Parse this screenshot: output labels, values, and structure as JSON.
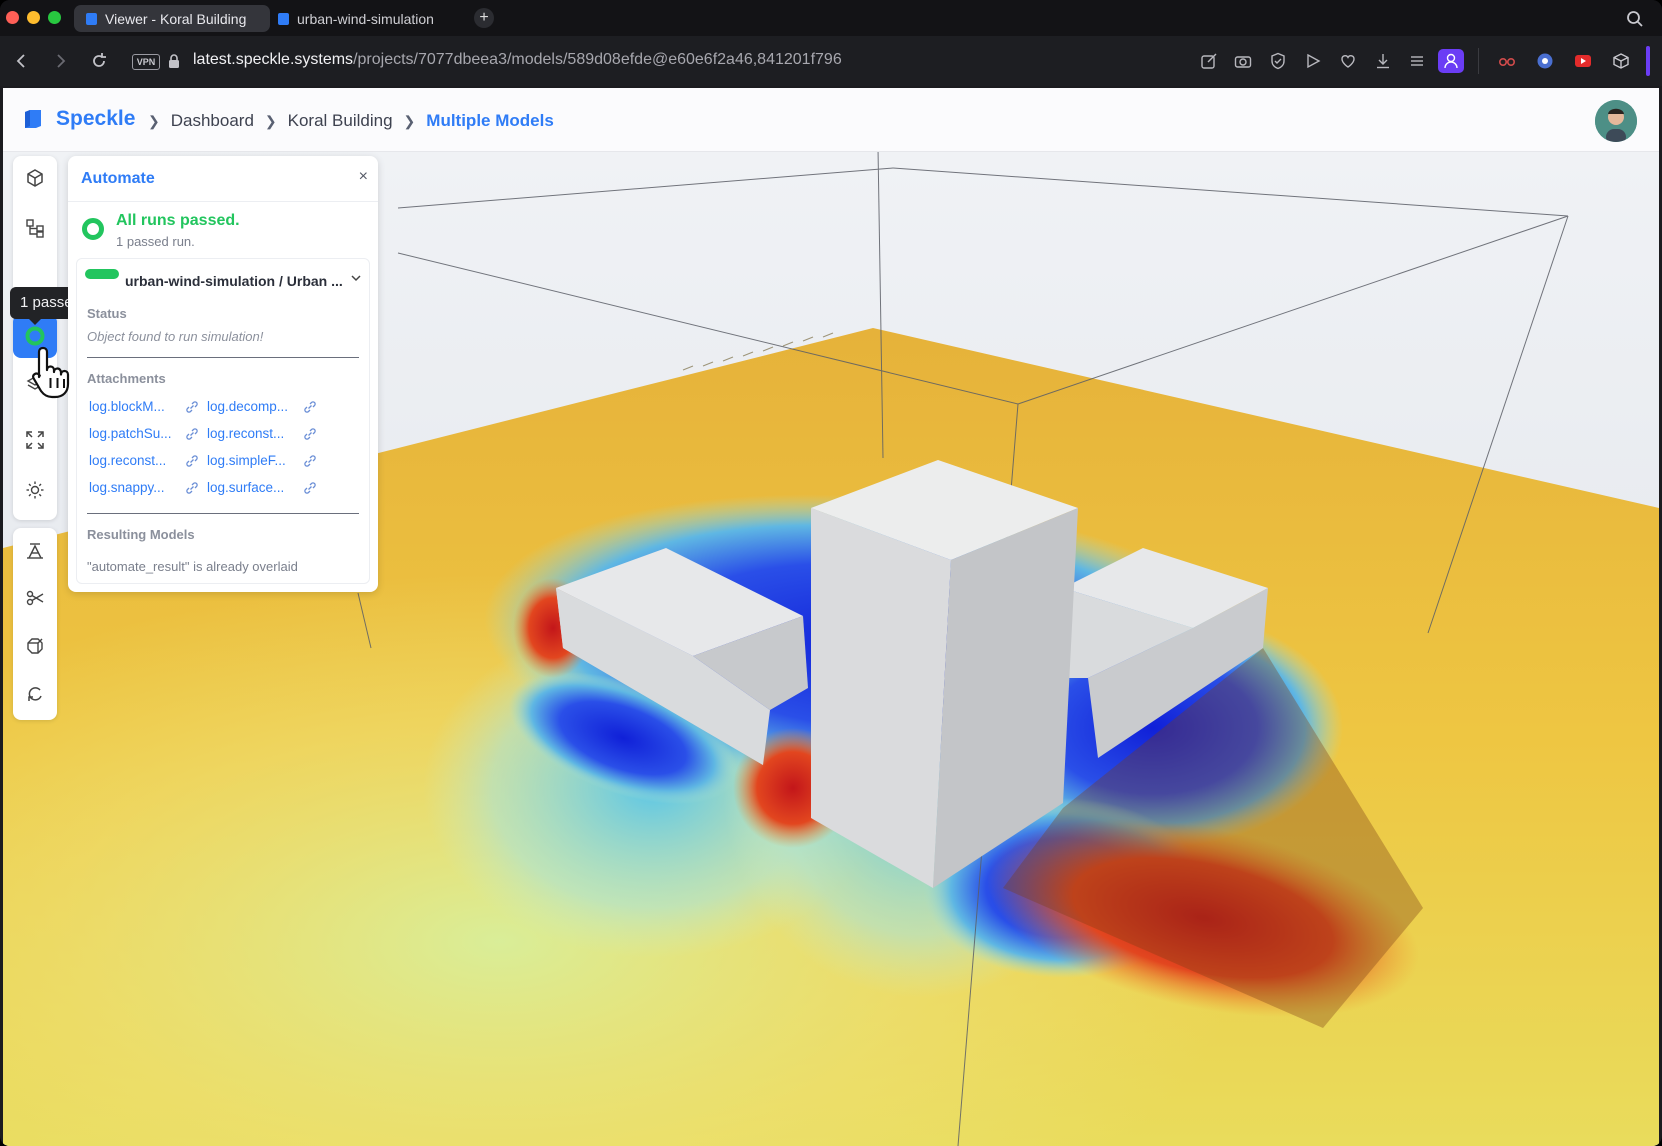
{
  "browser": {
    "tabs": [
      {
        "label": "Viewer - Koral Building",
        "active": true
      },
      {
        "label": "urban-wind-simulation",
        "active": false
      }
    ],
    "new_tab_label": "+",
    "vpn_label": "VPN",
    "url_host": "latest.speckle.systems",
    "url_path": "/projects/7077dbeea3/models/589d08efde@e60e6f2a46,841201f796"
  },
  "app": {
    "brand": "Speckle",
    "breadcrumb": [
      "Dashboard",
      "Koral Building",
      "Multiple Models"
    ],
    "accent_color": "#2f7cf6"
  },
  "tooltip": {
    "text": "1 passed run."
  },
  "automate": {
    "title": "Automate",
    "close_label": "×",
    "summary_title": "All runs passed.",
    "summary_subtitle": "1 passed run.",
    "success_color": "#22c55e",
    "run": {
      "title": "urban-wind-simulation / Urban ...",
      "status_label": "Status",
      "status_text": "Object found to run simulation!",
      "attachments_label": "Attachments",
      "attachments": [
        "log.blockM...",
        "log.decomp...",
        "log.patchSu...",
        "log.reconst...",
        "log.reconst...",
        "log.simpleF...",
        "log.snappy...",
        "log.surface..."
      ],
      "resulting_models_label": "Resulting Models",
      "resulting_models_text": "\"automate_result\" is already overlaid"
    }
  }
}
